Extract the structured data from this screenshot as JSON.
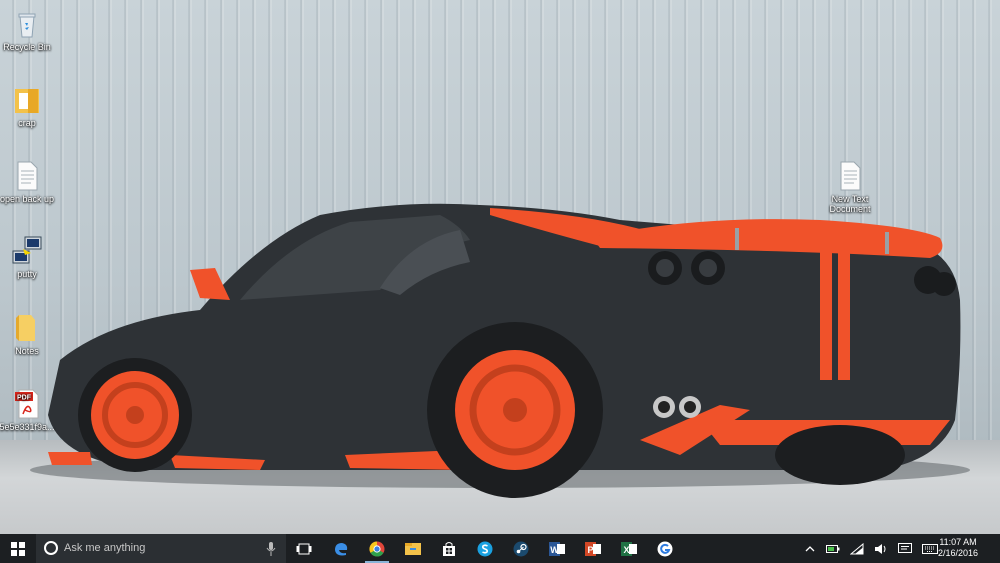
{
  "desktop_icons": [
    {
      "label": "Recycle Bin",
      "icon": "recycle-bin-icon"
    },
    {
      "label": "crap",
      "icon": "folder-icon"
    },
    {
      "label": "open back up",
      "icon": "text-document-icon"
    },
    {
      "label": "putty",
      "icon": "putty-icon"
    },
    {
      "label": "Notes",
      "icon": "folder-icon"
    },
    {
      "label": "5e5e331f9a...",
      "icon": "pdf-icon"
    },
    {
      "label": "New Text Document",
      "icon": "text-document-icon"
    }
  ],
  "wallpaper": {
    "subject": "car-wallpaper",
    "accent": "#f0522a",
    "body_color": "#2e3236"
  },
  "taskbar": {
    "search_placeholder": "Ask me anything",
    "apps": [
      "task-view-icon",
      "edge-icon",
      "chrome-icon",
      "file-explorer-icon",
      "store-icon",
      "skype-icon",
      "steam-icon",
      "word-icon",
      "powerpoint-icon",
      "excel-icon",
      "chat-icon"
    ],
    "clock_time": "11:07 AM",
    "clock_date": "2/16/2016",
    "pdf_text": "PDF"
  }
}
